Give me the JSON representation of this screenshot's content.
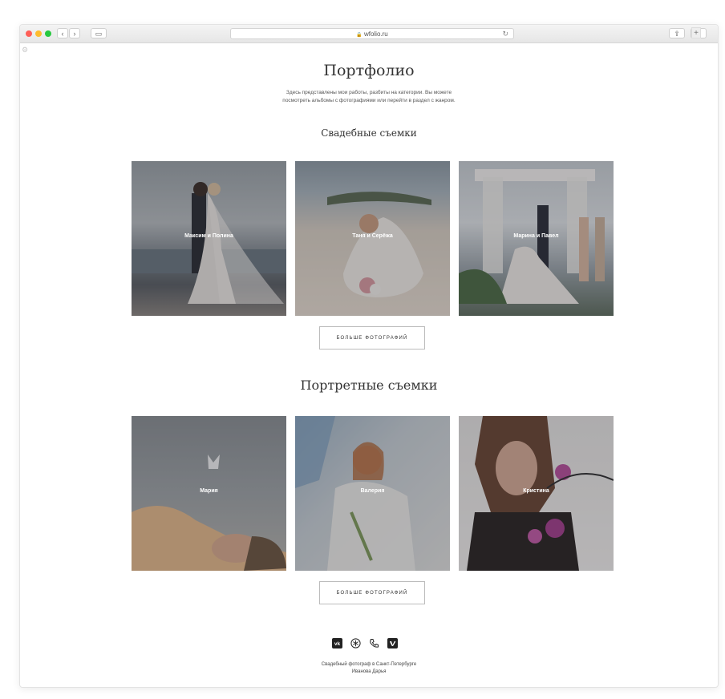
{
  "browser": {
    "url": "wfolio.ru",
    "lock_glyph": "🔒"
  },
  "page": {
    "title": "Портфолио",
    "intro_line1": "Здесь представлены мои работы, разбиты на категории. Вы можете",
    "intro_line2": "посмотреть альбомы с фотографиями или перейти в раздел с жанром."
  },
  "sections": [
    {
      "title": "Свадебные съемки",
      "cards": [
        {
          "label": "Максим и Полина"
        },
        {
          "label": "Таня и Серёжа"
        },
        {
          "label": "Марина и Павел"
        }
      ],
      "more_label": "БОЛЬШЕ ФОТОГРАФИЙ"
    },
    {
      "title": "Портретные съемки",
      "cards": [
        {
          "label": "Мария"
        },
        {
          "label": "Валерия"
        },
        {
          "label": "Кристина"
        }
      ],
      "more_label": "БОЛЬШЕ ФОТОГРАФИЙ"
    }
  ],
  "social_icons": [
    "vk-icon",
    "flower-icon",
    "phone-icon",
    "vimeo-icon"
  ],
  "footer": {
    "line1": "Свадебный фотограф в Санкт-Петербурге",
    "line2": "Иванова Дарья"
  }
}
